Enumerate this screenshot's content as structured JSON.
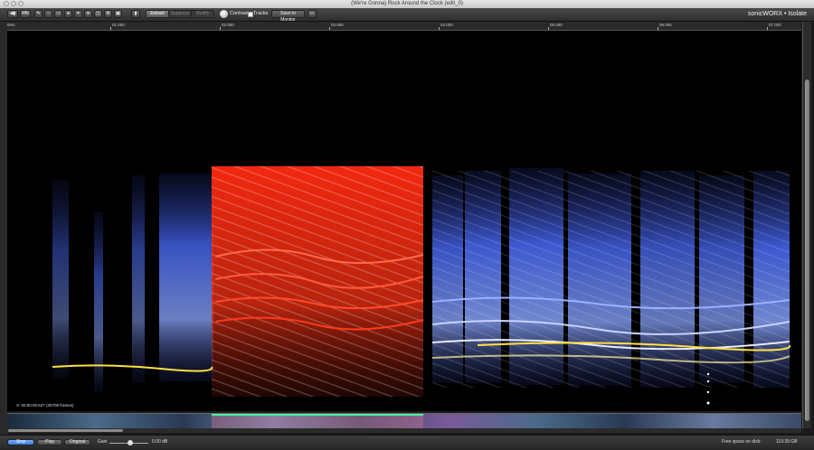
{
  "window": {
    "title": "(We're Gonna) Rock Around the Clock (edit_0)"
  },
  "toolbar": {
    "zoom_label": "Rfit",
    "modes": [
      {
        "label": "Extract",
        "active": true
      },
      {
        "label": "Suppress",
        "active": false
      },
      {
        "label": "Modify",
        "active": false
      }
    ],
    "contrast_label": "Contrast",
    "tracks_label": "Tracks",
    "save_button_label": "Save to Monitor",
    "brand": "sonicWORX • Isolate"
  },
  "ruler": {
    "ticks": [
      "0ms",
      "01.000",
      "02.000",
      "03.000",
      "04.000",
      "05.000",
      "06.000",
      "07.000"
    ]
  },
  "readout": {
    "position": "X: 00:00:00.637 (30709 frames)",
    "frequency": "Y: 6.18 Hz (C -1)"
  },
  "transport": {
    "stop_label": "Stop",
    "play_label": "Play",
    "original_label": "Original",
    "gain_label": "Gain",
    "gain_value": "0.00 dB"
  },
  "view_modes": [
    {
      "label": "Initial mix",
      "active": false
    },
    {
      "label": "Instrumental Editor",
      "active": true
    },
    {
      "label": "Output mix",
      "active": false
    }
  ],
  "status": {
    "free_space_label": "Free space on disk:",
    "free_space_value": "119.39 GB"
  },
  "colors": {
    "selection": "#ff3b20",
    "spectrum": "#4a6cff",
    "harmonic": "#ffe040",
    "timeline_selection": "#4bf0a0"
  }
}
